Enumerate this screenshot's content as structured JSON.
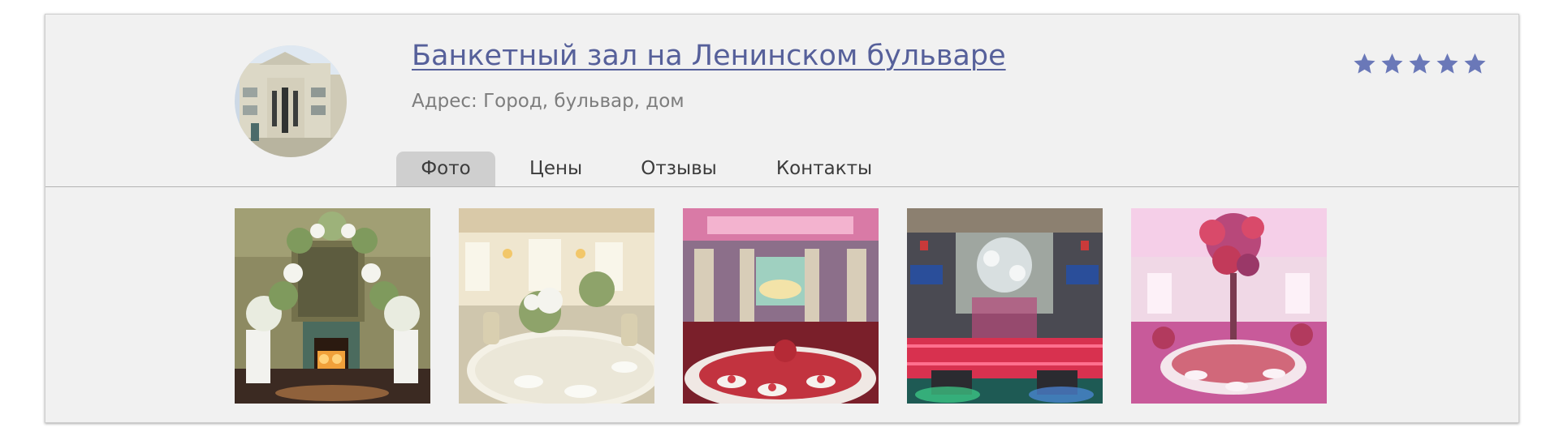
{
  "venue": {
    "title": "Банкетный зал на Ленинском бульваре",
    "address": "Адрес: Город, бульвар, дом",
    "rating": {
      "value": 5,
      "max": 5,
      "color": "#6a78b8"
    }
  },
  "tabs": [
    {
      "label": "Фото",
      "active": true
    },
    {
      "label": "Цены",
      "active": false
    },
    {
      "label": "Отзывы",
      "active": false
    },
    {
      "label": "Контакты",
      "active": false
    }
  ],
  "colors": {
    "title_link": "#56609a",
    "card_background": "#f1f1f1",
    "active_tab": "#cfcfcf"
  }
}
